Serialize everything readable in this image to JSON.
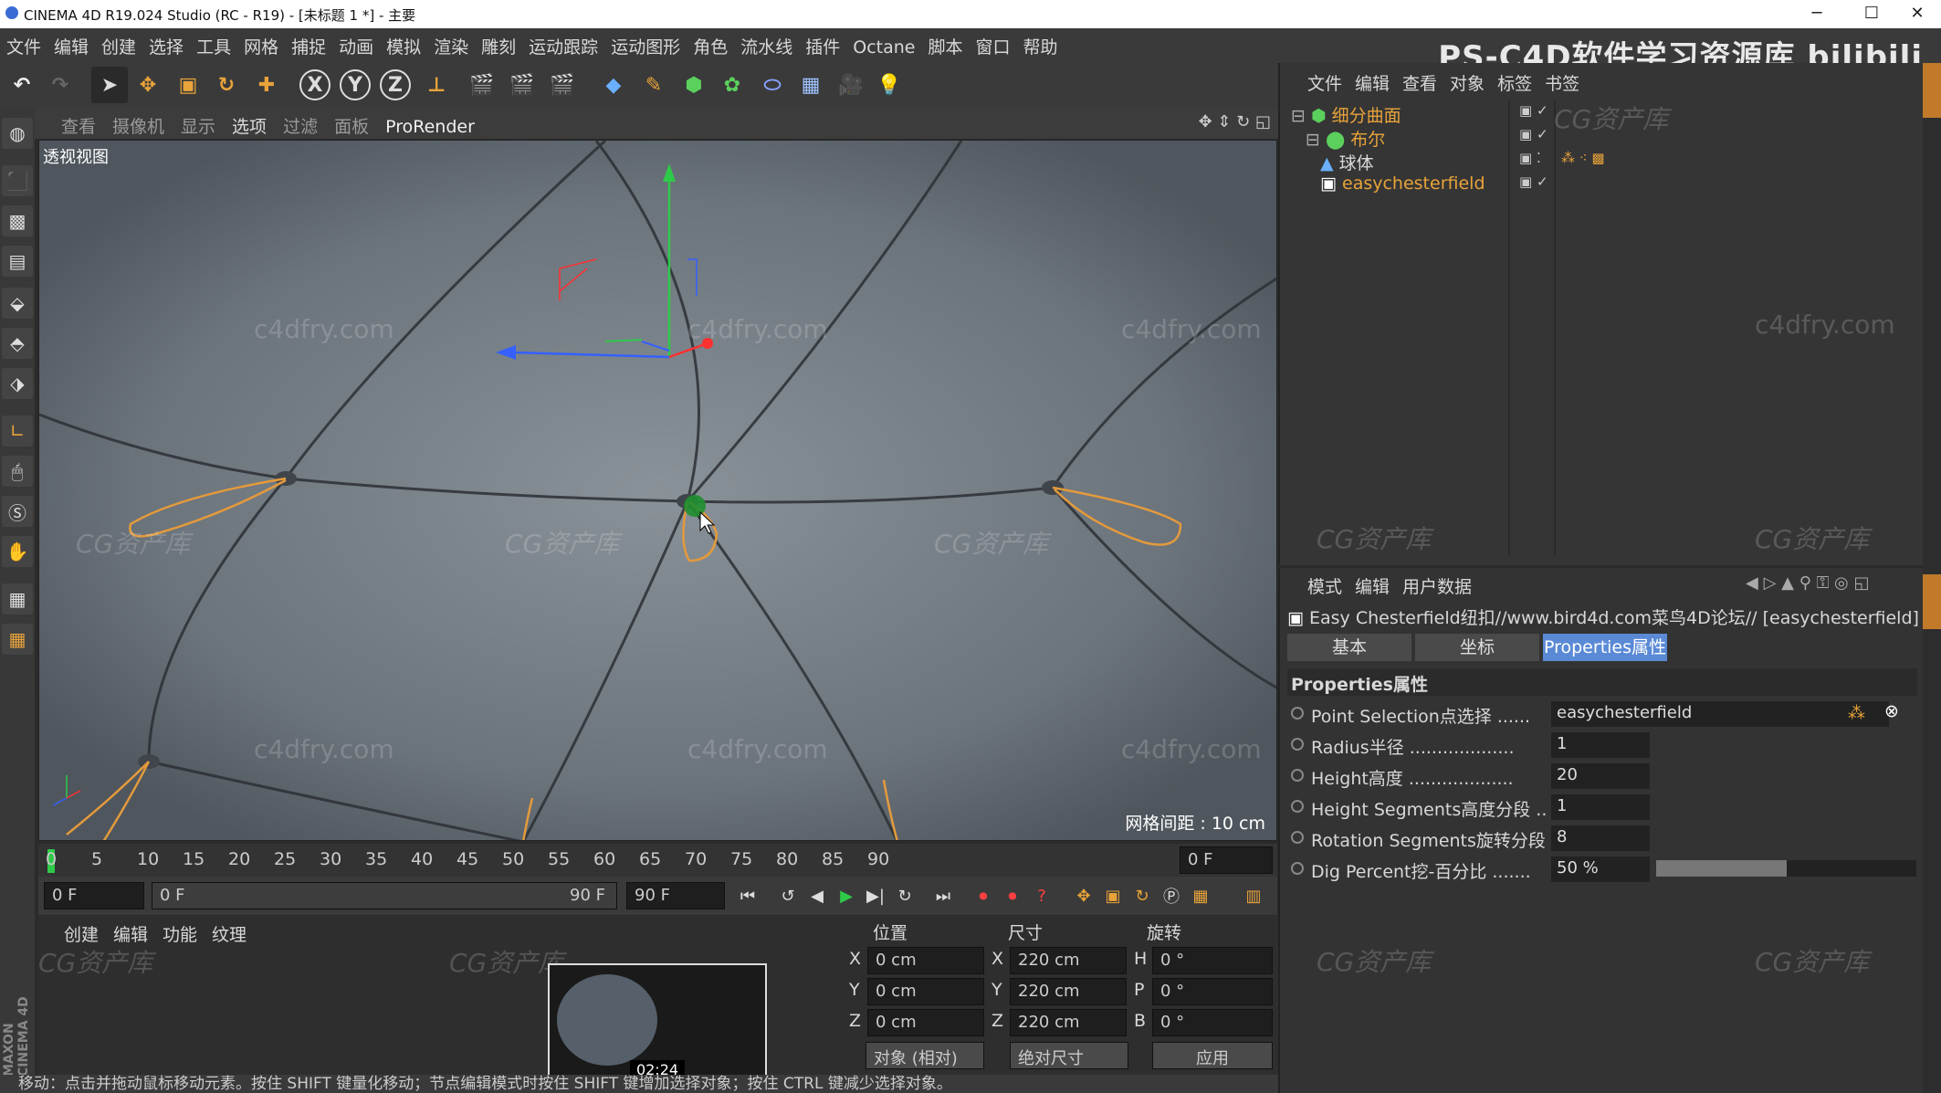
{
  "window": {
    "title": "CINEMA 4D R19.024 Studio (RC - R19) - [未标题 1 *] - 主要",
    "minimize": "─",
    "maximize": "☐",
    "close": "✕"
  },
  "menubar": {
    "items": [
      "文件",
      "编辑",
      "创建",
      "选择",
      "工具",
      "网格",
      "捕捉",
      "动画",
      "模拟",
      "渲染",
      "雕刻",
      "运动跟踪",
      "运动图形",
      "角色",
      "流水线",
      "插件",
      "Octane",
      "脚本",
      "窗口",
      "帮助"
    ],
    "brand": "PS-C4D软件学习资源库 bilibili"
  },
  "toolbar": {
    "undo_icon": "undo-icon",
    "redo_icon": "redo-icon",
    "x": "X",
    "y": "Y",
    "z": "Z"
  },
  "viewport": {
    "menus": [
      "查看",
      "摄像机",
      "显示",
      "选项",
      "过滤",
      "面板",
      "ProRender"
    ],
    "label": "透视视图",
    "grid_info": "网格间距 : 10 cm",
    "watermarks": [
      "c4dfry.com",
      "CG资产库"
    ]
  },
  "timeline": {
    "ticks": [
      "0",
      "5",
      "10",
      "15",
      "20",
      "25",
      "30",
      "35",
      "40",
      "45",
      "50",
      "55",
      "60",
      "65",
      "70",
      "75",
      "80",
      "85",
      "90"
    ],
    "current_frame": "0 F"
  },
  "playback": {
    "start": "0 F",
    "range_start": "0 F",
    "range_end": "90 F",
    "end": "90 F"
  },
  "materials": {
    "tabs": [
      "创建",
      "编辑",
      "功能",
      "纹理"
    ]
  },
  "video": {
    "time": "02:24"
  },
  "coords": {
    "headers": [
      "位置",
      "尺寸",
      "旋转"
    ],
    "rows": [
      {
        "axis": "X",
        "pos": "0 cm",
        "size_axis": "X",
        "size": "220 cm",
        "rot_axis": "H",
        "rot": "0 °"
      },
      {
        "axis": "Y",
        "pos": "0 cm",
        "size_axis": "Y",
        "size": "220 cm",
        "rot_axis": "P",
        "rot": "0 °"
      },
      {
        "axis": "Z",
        "pos": "0 cm",
        "size_axis": "Z",
        "size": "220 cm",
        "rot_axis": "B",
        "rot": "0 °"
      }
    ],
    "mode1": "对象 (相对)",
    "mode2": "绝对尺寸",
    "apply": "应用"
  },
  "status": "移动：点击并拖动鼠标移动元素。按住 SHIFT 键量化移动；节点编辑模式时按住 SHIFT 键增加选择对象；按住 CTRL 键减少选择对象。",
  "objects": {
    "menus": [
      "文件",
      "编辑",
      "查看",
      "对象",
      "标签",
      "书签"
    ],
    "tree": [
      {
        "name": "细分曲面",
        "color": "#e8a33a"
      },
      {
        "name": "布尔",
        "color": "#e8a33a"
      },
      {
        "name": "球体",
        "color": "#d8d8d8"
      },
      {
        "name": "easychesterfield",
        "color": "#e8a33a"
      }
    ]
  },
  "attributes": {
    "menus": [
      "模式",
      "编辑",
      "用户数据"
    ],
    "object_title": "Easy Chesterfield纽扣//www.bird4d.com菜鸟4D论坛// [easychesterfield]",
    "tabs": [
      "基本",
      "坐标",
      "Properties属性"
    ],
    "section": "Properties属性",
    "props": [
      {
        "label": "Point Selection点选择 ......",
        "value": "easychesterfield"
      },
      {
        "label": "Radius半径 ...................",
        "value": "1"
      },
      {
        "label": "Height高度 ...................",
        "value": "20"
      },
      {
        "label": "Height Segments高度分段 ..",
        "value": "1"
      },
      {
        "label": "Rotation Segments旋转分段",
        "value": "8"
      },
      {
        "label": "Dig Percent挖-百分比 .......",
        "value": "50 %"
      }
    ],
    "dig_percent": 0.5
  },
  "sidebar": {
    "maxon": "MAXON CINEMA 4D"
  }
}
